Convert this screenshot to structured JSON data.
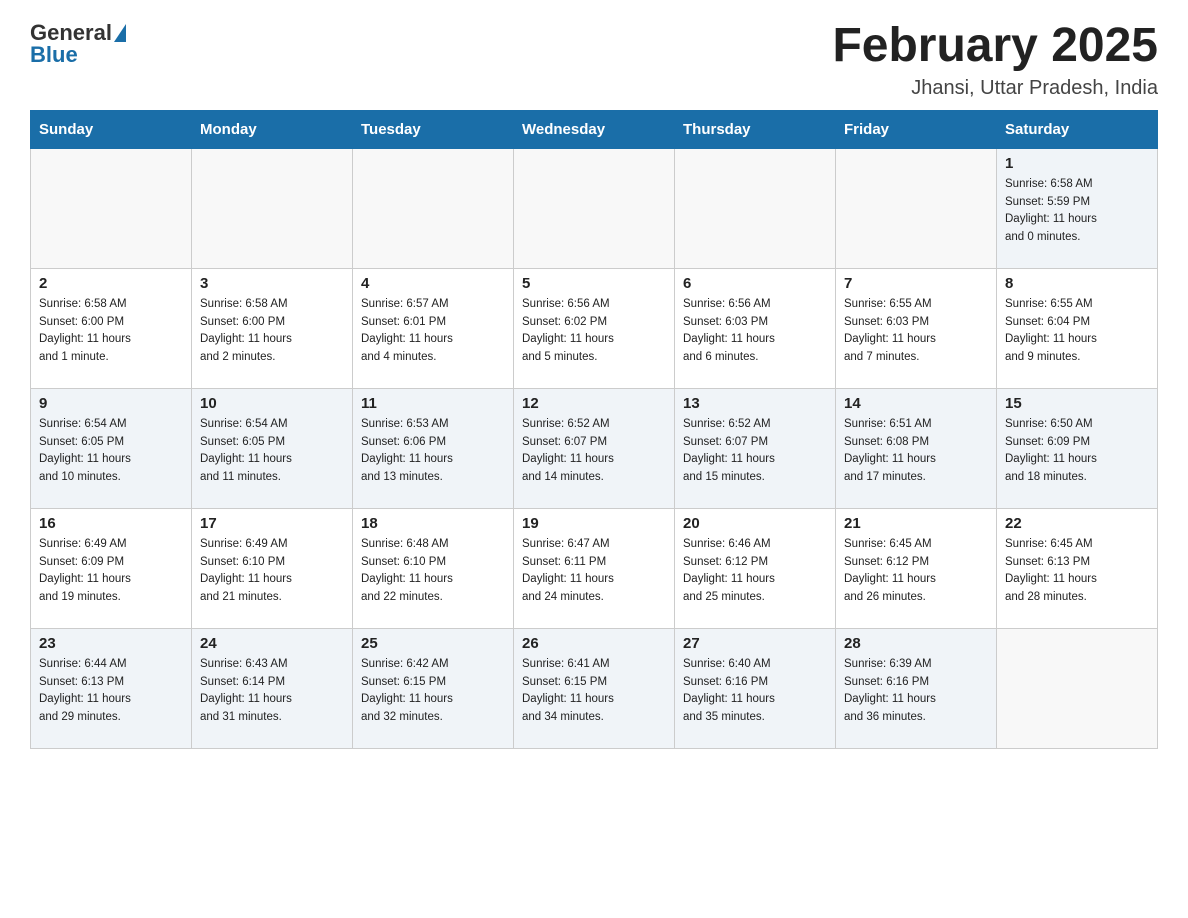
{
  "header": {
    "logo_general": "General",
    "logo_blue": "Blue",
    "month_title": "February 2025",
    "location": "Jhansi, Uttar Pradesh, India"
  },
  "weekdays": [
    "Sunday",
    "Monday",
    "Tuesday",
    "Wednesday",
    "Thursday",
    "Friday",
    "Saturday"
  ],
  "weeks": [
    [
      {
        "day": "",
        "info": ""
      },
      {
        "day": "",
        "info": ""
      },
      {
        "day": "",
        "info": ""
      },
      {
        "day": "",
        "info": ""
      },
      {
        "day": "",
        "info": ""
      },
      {
        "day": "",
        "info": ""
      },
      {
        "day": "1",
        "info": "Sunrise: 6:58 AM\nSunset: 5:59 PM\nDaylight: 11 hours\nand 0 minutes."
      }
    ],
    [
      {
        "day": "2",
        "info": "Sunrise: 6:58 AM\nSunset: 6:00 PM\nDaylight: 11 hours\nand 1 minute."
      },
      {
        "day": "3",
        "info": "Sunrise: 6:58 AM\nSunset: 6:00 PM\nDaylight: 11 hours\nand 2 minutes."
      },
      {
        "day": "4",
        "info": "Sunrise: 6:57 AM\nSunset: 6:01 PM\nDaylight: 11 hours\nand 4 minutes."
      },
      {
        "day": "5",
        "info": "Sunrise: 6:56 AM\nSunset: 6:02 PM\nDaylight: 11 hours\nand 5 minutes."
      },
      {
        "day": "6",
        "info": "Sunrise: 6:56 AM\nSunset: 6:03 PM\nDaylight: 11 hours\nand 6 minutes."
      },
      {
        "day": "7",
        "info": "Sunrise: 6:55 AM\nSunset: 6:03 PM\nDaylight: 11 hours\nand 7 minutes."
      },
      {
        "day": "8",
        "info": "Sunrise: 6:55 AM\nSunset: 6:04 PM\nDaylight: 11 hours\nand 9 minutes."
      }
    ],
    [
      {
        "day": "9",
        "info": "Sunrise: 6:54 AM\nSunset: 6:05 PM\nDaylight: 11 hours\nand 10 minutes."
      },
      {
        "day": "10",
        "info": "Sunrise: 6:54 AM\nSunset: 6:05 PM\nDaylight: 11 hours\nand 11 minutes."
      },
      {
        "day": "11",
        "info": "Sunrise: 6:53 AM\nSunset: 6:06 PM\nDaylight: 11 hours\nand 13 minutes."
      },
      {
        "day": "12",
        "info": "Sunrise: 6:52 AM\nSunset: 6:07 PM\nDaylight: 11 hours\nand 14 minutes."
      },
      {
        "day": "13",
        "info": "Sunrise: 6:52 AM\nSunset: 6:07 PM\nDaylight: 11 hours\nand 15 minutes."
      },
      {
        "day": "14",
        "info": "Sunrise: 6:51 AM\nSunset: 6:08 PM\nDaylight: 11 hours\nand 17 minutes."
      },
      {
        "day": "15",
        "info": "Sunrise: 6:50 AM\nSunset: 6:09 PM\nDaylight: 11 hours\nand 18 minutes."
      }
    ],
    [
      {
        "day": "16",
        "info": "Sunrise: 6:49 AM\nSunset: 6:09 PM\nDaylight: 11 hours\nand 19 minutes."
      },
      {
        "day": "17",
        "info": "Sunrise: 6:49 AM\nSunset: 6:10 PM\nDaylight: 11 hours\nand 21 minutes."
      },
      {
        "day": "18",
        "info": "Sunrise: 6:48 AM\nSunset: 6:10 PM\nDaylight: 11 hours\nand 22 minutes."
      },
      {
        "day": "19",
        "info": "Sunrise: 6:47 AM\nSunset: 6:11 PM\nDaylight: 11 hours\nand 24 minutes."
      },
      {
        "day": "20",
        "info": "Sunrise: 6:46 AM\nSunset: 6:12 PM\nDaylight: 11 hours\nand 25 minutes."
      },
      {
        "day": "21",
        "info": "Sunrise: 6:45 AM\nSunset: 6:12 PM\nDaylight: 11 hours\nand 26 minutes."
      },
      {
        "day": "22",
        "info": "Sunrise: 6:45 AM\nSunset: 6:13 PM\nDaylight: 11 hours\nand 28 minutes."
      }
    ],
    [
      {
        "day": "23",
        "info": "Sunrise: 6:44 AM\nSunset: 6:13 PM\nDaylight: 11 hours\nand 29 minutes."
      },
      {
        "day": "24",
        "info": "Sunrise: 6:43 AM\nSunset: 6:14 PM\nDaylight: 11 hours\nand 31 minutes."
      },
      {
        "day": "25",
        "info": "Sunrise: 6:42 AM\nSunset: 6:15 PM\nDaylight: 11 hours\nand 32 minutes."
      },
      {
        "day": "26",
        "info": "Sunrise: 6:41 AM\nSunset: 6:15 PM\nDaylight: 11 hours\nand 34 minutes."
      },
      {
        "day": "27",
        "info": "Sunrise: 6:40 AM\nSunset: 6:16 PM\nDaylight: 11 hours\nand 35 minutes."
      },
      {
        "day": "28",
        "info": "Sunrise: 6:39 AM\nSunset: 6:16 PM\nDaylight: 11 hours\nand 36 minutes."
      },
      {
        "day": "",
        "info": ""
      }
    ]
  ]
}
